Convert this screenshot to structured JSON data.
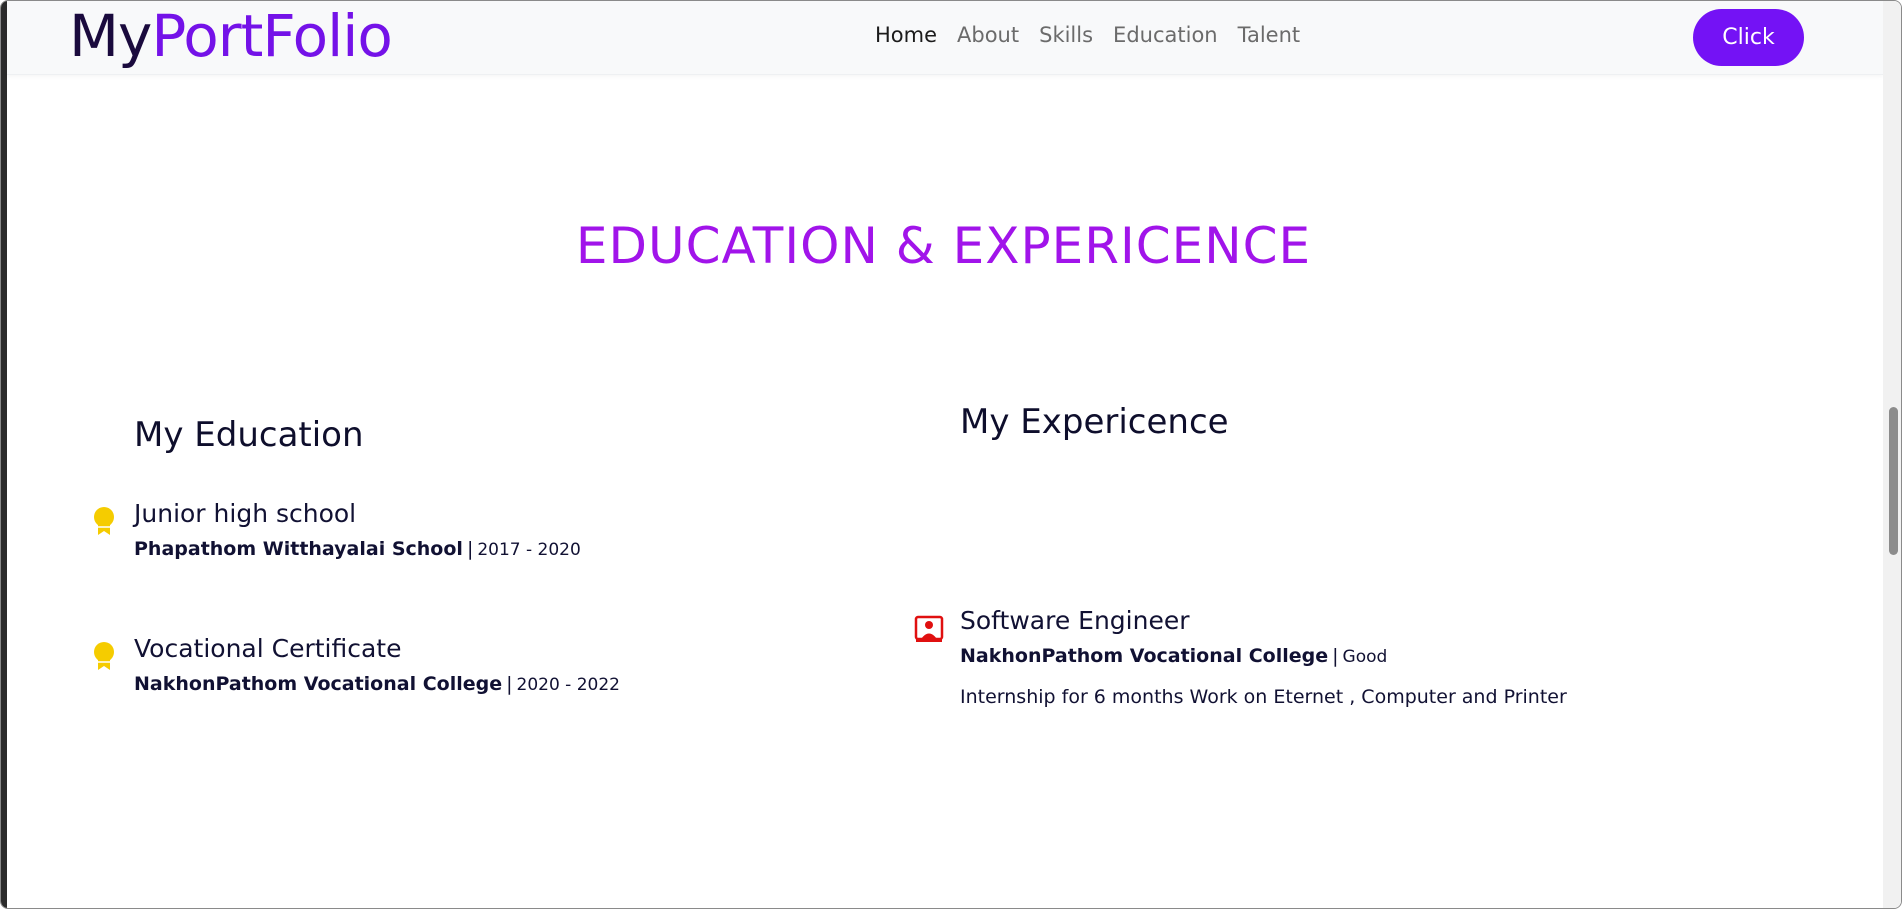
{
  "navbar": {
    "brand_my": "My",
    "brand_portfolio": "PortFolio",
    "links": [
      "Home",
      "About",
      "Skills",
      "Education",
      "Talent"
    ],
    "cta_label": "Click"
  },
  "section": {
    "title": "EDUCATION & EXPERICENCE"
  },
  "education": {
    "heading": "My Education",
    "items": [
      {
        "title": "Junior high school",
        "school": "Phapathom Witthayalai School",
        "years": "2017 - 2020",
        "icon": "medal-icon"
      },
      {
        "title": "Vocational Certificate",
        "school": "NakhonPathom Vocational College",
        "years": "2020 - 2022",
        "icon": "medal-icon"
      }
    ]
  },
  "experience": {
    "heading": "My Expericence",
    "items": [
      {
        "title": "Software Engineer",
        "org": "NakhonPathom Vocational College",
        "rating": "Good",
        "description": "Internship for 6 months Work on Eternet , Computer and Printer",
        "icon": "person-presentation-icon"
      }
    ]
  },
  "colors": {
    "brand_dark": "#1a0a3d",
    "brand_accent": "#7412e8",
    "title_purple": "#a114ea",
    "button_purple": "#7412f5",
    "medal_yellow": "#f5cc00",
    "person_icon_red": "#e01010"
  }
}
